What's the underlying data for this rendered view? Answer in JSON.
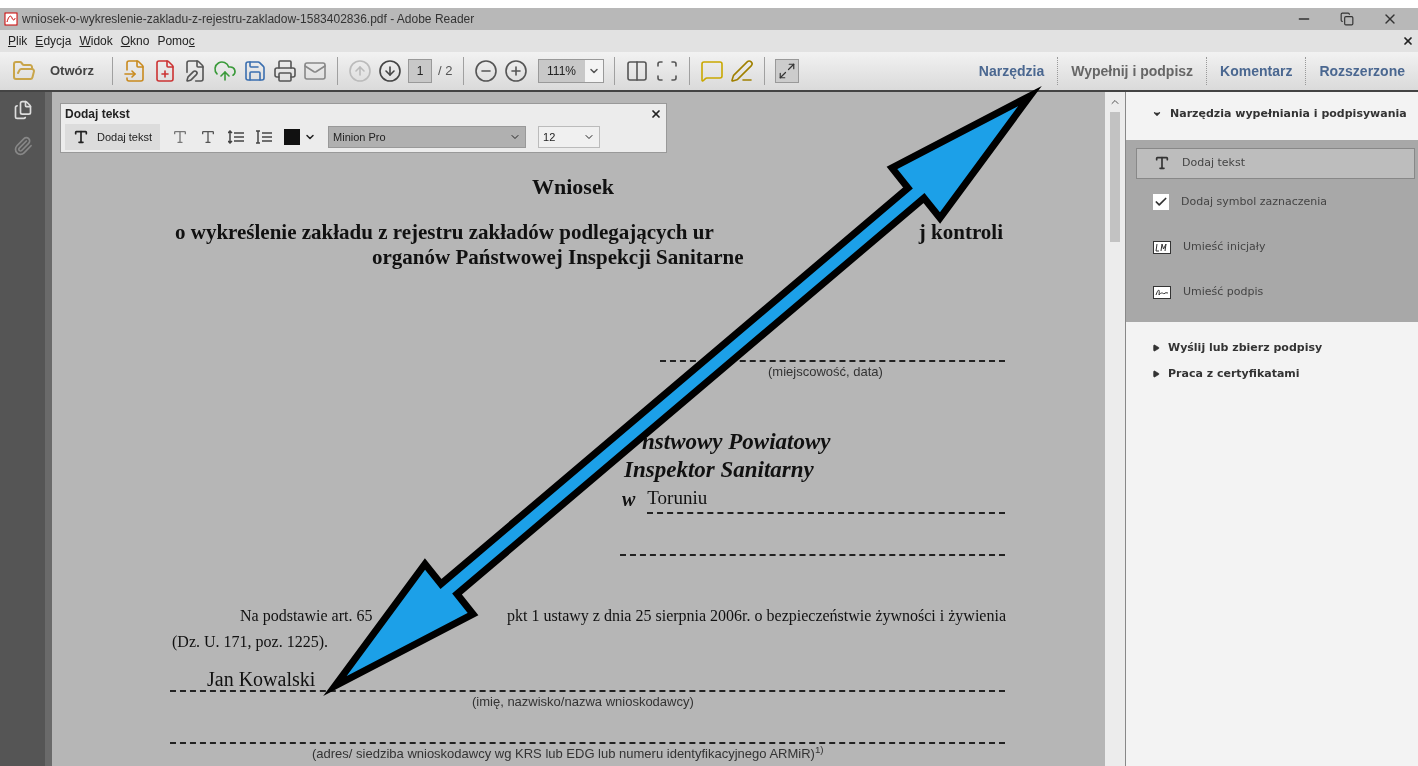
{
  "window": {
    "title": "wniosek-o-wykreslenie-zakladu-z-rejestru-zakladow-1583402836.pdf - Adobe Reader"
  },
  "menu": [
    {
      "key": "P",
      "post": "lik"
    },
    {
      "key": "E",
      "post": "dycja"
    },
    {
      "key": "W",
      "post": "idok"
    },
    {
      "key": "O",
      "post": "kno"
    },
    {
      "pre": "Pomo",
      "key": "c"
    }
  ],
  "toolbar": {
    "open_button": "Otwórz",
    "page_field": {
      "value": "1"
    },
    "page_count": "/ 2",
    "zoom_field": {
      "value": "111%"
    }
  },
  "panel_tabs": [
    {
      "label": "Narzędzia",
      "selected": false
    },
    {
      "label": "Wypełnij i podpisz",
      "selected": true
    },
    {
      "label": "Komentarz",
      "selected": false
    },
    {
      "label": "Rozszerzone",
      "selected": false
    }
  ],
  "text_toolbar": {
    "title": "Dodaj tekst",
    "add_text_button": "Dodaj tekst",
    "font_field": {
      "value": "Minion Pro"
    },
    "size_field": {
      "value": "12"
    }
  },
  "right_panel": {
    "sections": [
      {
        "label": "Narzędzia wypełniania i podpisywania",
        "expanded": true,
        "items": [
          {
            "label": "Dodaj tekst",
            "kind": "text",
            "selected": true
          },
          {
            "label": "Dodaj symbol zaznaczenia",
            "kind": "check",
            "selected": false
          },
          {
            "label": "Umieść inicjały",
            "kind": "initials",
            "selected": false
          },
          {
            "label": "Umieść podpis",
            "kind": "signature",
            "selected": false
          }
        ]
      },
      {
        "label": "Wyślij lub zbierz podpisy",
        "expanded": false
      },
      {
        "label": "Praca z certyfikatami",
        "expanded": false
      }
    ]
  },
  "document": {
    "title": "Wniosek",
    "heading_line_1": [
      "o wykreślenie zakładu z rejestru zakładów podlegających ur",
      "j kontroli"
    ],
    "heading_line_2": "organów Państwowej Inspekcji Sanitarne",
    "place_date_caption": "(miejscowość, data)",
    "addressee": [
      "nstwowy Powiatowy",
      "Inspektor Sanitarny"
    ],
    "addressee_prefix": "w",
    "city": "Toruniu",
    "paragraph_line_1": [
      "Na podstawie art. 65",
      "pkt 1 ustawy z dnia 25 sierpnia 2006r. o bezpieczeństwie żywności i żywienia"
    ],
    "paragraph_line_2": "(Dz. U. 171, poz. 1225).",
    "applicant_name": "Jan Kowalski",
    "applicant_caption": "(imię, nazwisko/nazwa wnioskodawcy)",
    "address_caption": "(adres/ siedziba wnioskodawcy wg KRS lub EDG lub numeru identyfikacyjnego ARMiR)$^{1)}$"
  }
}
